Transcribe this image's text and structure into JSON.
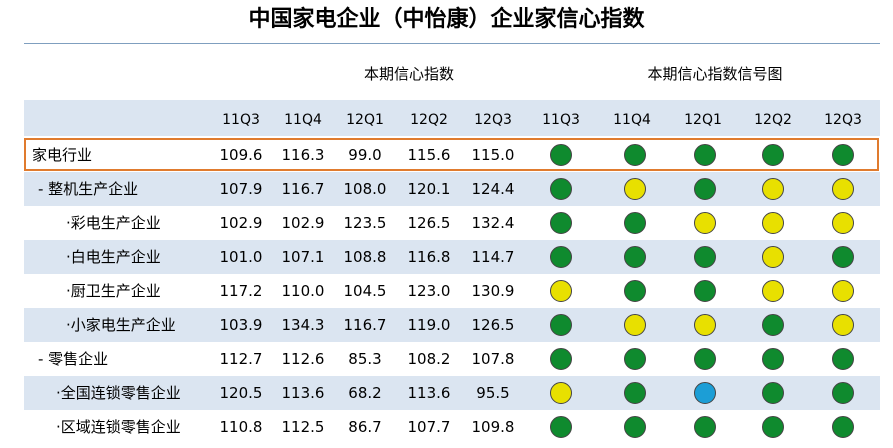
{
  "title": "中国家电企业（中怡康）企业家信心指数",
  "group_headers": {
    "values": "本期信心指数",
    "signals": "本期信心指数信号图"
  },
  "colors": {
    "green": "#0f8a2e",
    "yellow": "#e8e000",
    "blue": "#1c9ed6",
    "highlight_border": "#e07b2e",
    "shade": "#dbe5f1"
  },
  "chart_data": {
    "type": "table",
    "columns": [
      "11Q3",
      "11Q4",
      "12Q1",
      "12Q2",
      "12Q3"
    ],
    "rows": [
      {
        "label": "家电行业",
        "values": [
          "109.6",
          "116.3",
          "99.0",
          "115.6",
          "115.0"
        ],
        "signals": [
          "green",
          "green",
          "green",
          "green",
          "green"
        ]
      },
      {
        "label": "- 整机生产企业",
        "values": [
          "107.9",
          "116.7",
          "108.0",
          "120.1",
          "124.4"
        ],
        "signals": [
          "green",
          "yellow",
          "green",
          "yellow",
          "yellow"
        ]
      },
      {
        "label": "·彩电生产企业",
        "values": [
          "102.9",
          "102.9",
          "123.5",
          "126.5",
          "132.4"
        ],
        "signals": [
          "green",
          "green",
          "yellow",
          "yellow",
          "yellow"
        ]
      },
      {
        "label": "·白电生产企业",
        "values": [
          "101.0",
          "107.1",
          "108.8",
          "116.8",
          "114.7"
        ],
        "signals": [
          "green",
          "green",
          "green",
          "yellow",
          "green"
        ]
      },
      {
        "label": "·厨卫生产企业",
        "values": [
          "117.2",
          "110.0",
          "104.5",
          "123.0",
          "130.9"
        ],
        "signals": [
          "yellow",
          "green",
          "green",
          "yellow",
          "yellow"
        ]
      },
      {
        "label": "·小家电生产企业",
        "values": [
          "103.9",
          "134.3",
          "116.7",
          "119.0",
          "126.5"
        ],
        "signals": [
          "green",
          "yellow",
          "yellow",
          "green",
          "yellow"
        ]
      },
      {
        "label": "- 零售企业",
        "values": [
          "112.7",
          "112.6",
          "85.3",
          "108.2",
          "107.8"
        ],
        "signals": [
          "green",
          "green",
          "green",
          "green",
          "green"
        ]
      },
      {
        "label": "·全国连锁零售企业",
        "values": [
          "120.5",
          "113.6",
          "68.2",
          "113.6",
          "95.5"
        ],
        "signals": [
          "yellow",
          "green",
          "blue",
          "green",
          "green"
        ]
      },
      {
        "label": "·区域连锁零售企业",
        "values": [
          "110.8",
          "112.5",
          "86.7",
          "107.7",
          "109.8"
        ],
        "signals": [
          "green",
          "green",
          "green",
          "green",
          "green"
        ]
      }
    ]
  }
}
